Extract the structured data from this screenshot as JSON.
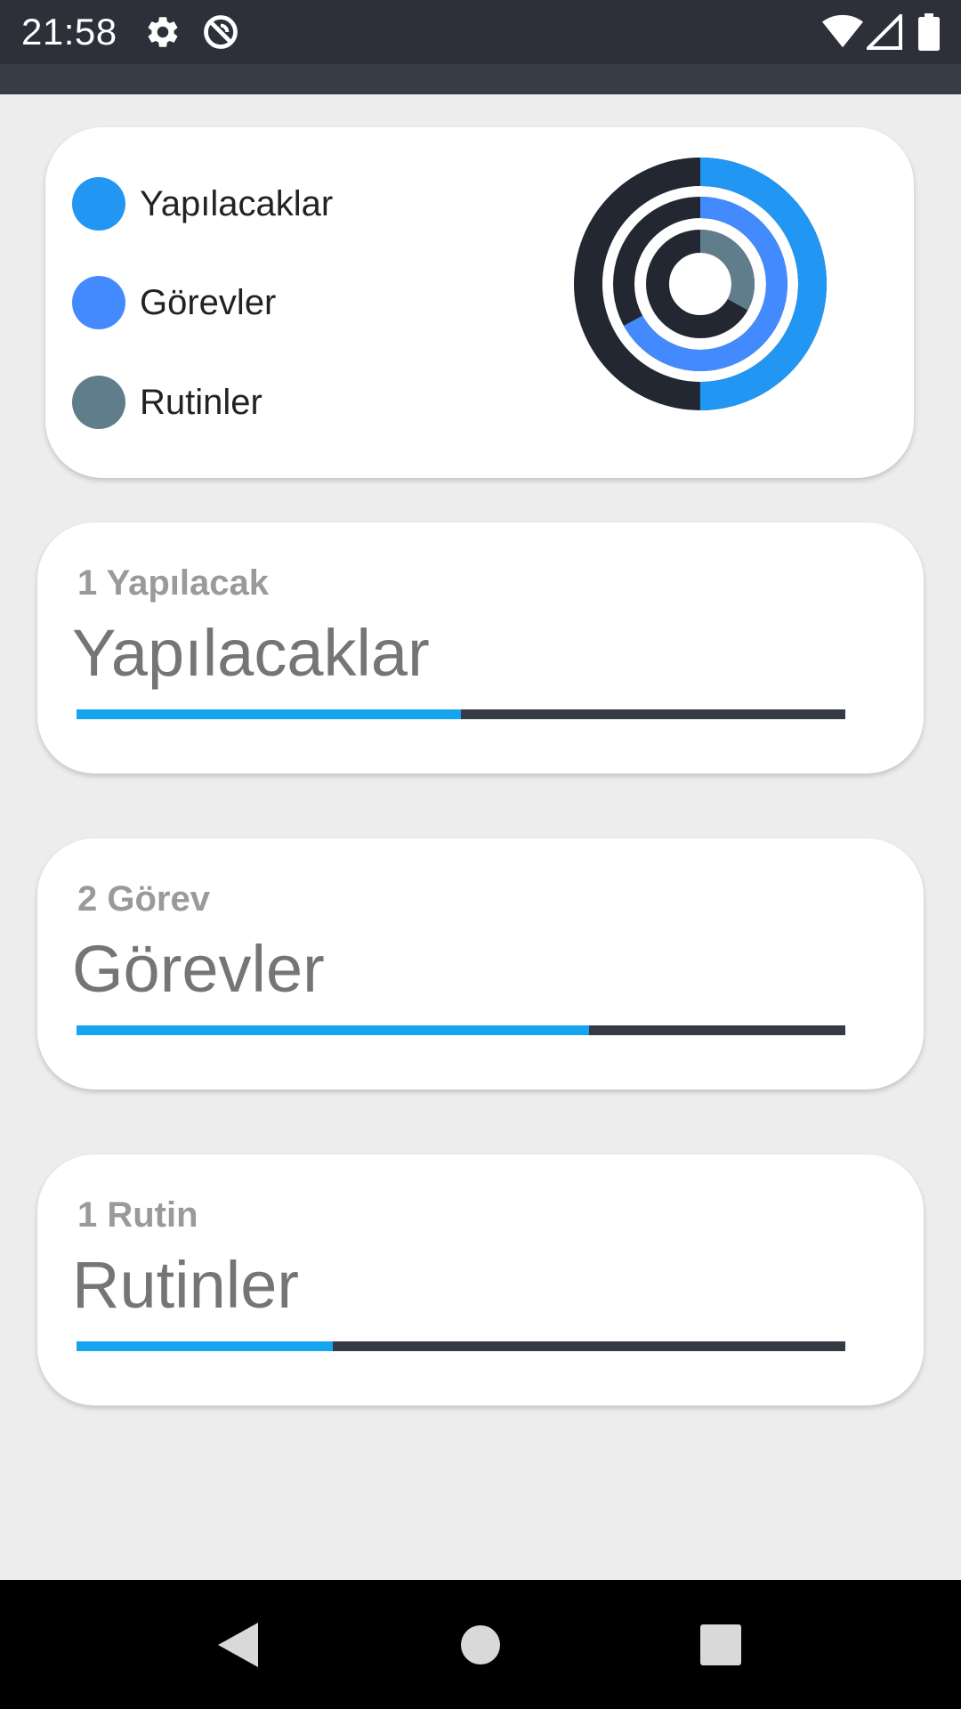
{
  "status_bar": {
    "time": "21:58",
    "icons": [
      "gear-icon",
      "no-entry-icon",
      "wifi-icon",
      "signal-icon",
      "battery-icon"
    ]
  },
  "summary": {
    "legend": [
      {
        "label": "Yapılacaklar",
        "color": "#2196f3"
      },
      {
        "label": "Görevler",
        "color": "#448aff"
      },
      {
        "label": "Rutinler",
        "color": "#607d8b"
      }
    ],
    "rings": [
      {
        "name": "Yapılacaklar",
        "color": "#2196f3",
        "fraction": 0.5
      },
      {
        "name": "Görevler",
        "color": "#448aff",
        "fraction": 0.67
      },
      {
        "name": "Rutinler",
        "color": "#607d8b",
        "fraction": 0.33
      }
    ],
    "ring_track_color": "#222732"
  },
  "categories": [
    {
      "count": "1 Yapılacak",
      "title": "Yapılacaklar",
      "progress": 0.5
    },
    {
      "count": "2 Görev",
      "title": "Görevler",
      "progress": 0.667
    },
    {
      "count": "1 Rutin",
      "title": "Rutinler",
      "progress": 0.333
    }
  ],
  "colors": {
    "progress_fill": "#14a5ee",
    "progress_track": "#353a44"
  },
  "nav": {
    "icons": [
      "back-icon",
      "home-icon",
      "recents-icon"
    ]
  }
}
